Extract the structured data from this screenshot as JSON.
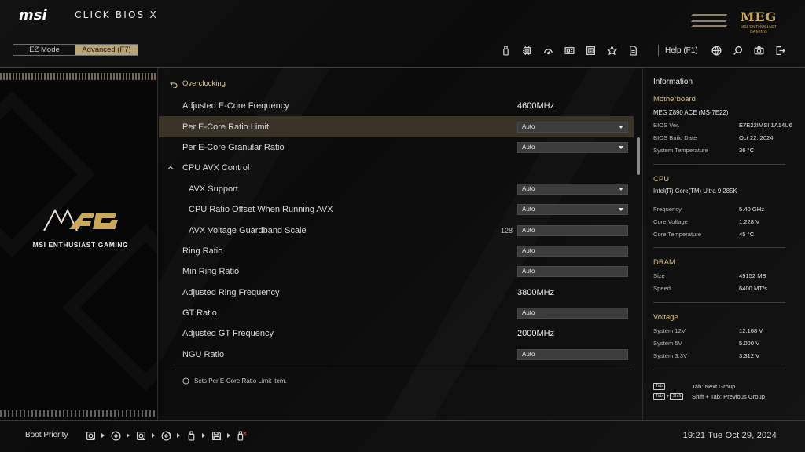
{
  "app": {
    "brand": "msi",
    "title": "CLICK BIOS X",
    "series_logo": "MEG",
    "series_caption": "MSI ENTHUSIAST GAMING"
  },
  "modes": {
    "ez": "EZ Mode",
    "advanced": "Advanced (F7)",
    "active": "advanced"
  },
  "toolbar": {
    "icons": [
      "usb-icon",
      "cpu-icon",
      "gauge-icon",
      "monitor-card-icon",
      "chip-board-icon",
      "star-icon",
      "file-icon"
    ],
    "help_label": "Help (F1)",
    "right_icons": [
      "globe-icon",
      "search-icon",
      "camera-icon",
      "exit-icon"
    ]
  },
  "left_panel": {
    "logo_caption": "MSI ENTHUSIAST GAMING"
  },
  "breadcrumb": "Overclocking",
  "settings": [
    {
      "label": "Adjusted E-Core Frequency",
      "type": "text",
      "value": "4600MHz",
      "indent": 0
    },
    {
      "label": "Per E-Core Ratio Limit",
      "type": "dropdown",
      "value": "Auto",
      "indent": 0,
      "selected": true
    },
    {
      "label": "Per E-Core Granular Ratio",
      "type": "dropdown",
      "value": "Auto",
      "indent": 0
    },
    {
      "label": "CPU AVX Control",
      "type": "group",
      "value": "",
      "indent": 0,
      "expanded": true
    },
    {
      "label": "AVX Support",
      "type": "dropdown",
      "value": "Auto",
      "indent": 1
    },
    {
      "label": "CPU Ratio Offset When Running AVX",
      "type": "dropdown",
      "value": "Auto",
      "indent": 1
    },
    {
      "label": "AVX Voltage Guardband Scale",
      "type": "input",
      "value": "Auto",
      "num": "128",
      "indent": 1
    },
    {
      "label": "Ring Ratio",
      "type": "input",
      "value": "Auto",
      "indent": 0
    },
    {
      "label": "Min Ring Ratio",
      "type": "input",
      "value": "Auto",
      "indent": 0
    },
    {
      "label": "Adjusted Ring Frequency",
      "type": "text",
      "value": "3800MHz",
      "indent": 0
    },
    {
      "label": "GT Ratio",
      "type": "input",
      "value": "Auto",
      "indent": 0
    },
    {
      "label": "Adjusted GT Frequency",
      "type": "text",
      "value": "2000MHz",
      "indent": 0
    },
    {
      "label": "NGU Ratio",
      "type": "input",
      "value": "Auto",
      "indent": 0
    }
  ],
  "help_text": "Sets Per E-Core Ratio Limit item.",
  "info": {
    "title": "Information",
    "motherboard": {
      "title": "Motherboard",
      "model": "MEG Z890 ACE (MS-7E22)",
      "rows": [
        {
          "k": "BIOS Ver.",
          "v": "E7E22IMSI.1A14U6"
        },
        {
          "k": "BIOS Build Date",
          "v": "Oct 22, 2024"
        },
        {
          "k": "System Temperature",
          "v": "36 °C"
        }
      ]
    },
    "cpu": {
      "title": "CPU",
      "model": "Intel(R) Core(TM) Ultra 9 285K",
      "rows": [
        {
          "k": "Frequency",
          "v": "5.40 GHz"
        },
        {
          "k": "Core Voltage",
          "v": "1.228 V"
        },
        {
          "k": "Core Temperature",
          "v": "45 °C"
        }
      ]
    },
    "dram": {
      "title": "DRAM",
      "rows": [
        {
          "k": "Size",
          "v": "49152 MB"
        },
        {
          "k": "Speed",
          "v": "6400 MT/s"
        }
      ]
    },
    "voltage": {
      "title": "Voltage",
      "rows": [
        {
          "k": "System 12V",
          "v": "12.168 V"
        },
        {
          "k": "System 5V",
          "v": "5.000 V"
        },
        {
          "k": "System 3.3V",
          "v": "3.312 V"
        }
      ]
    },
    "keys": [
      {
        "caps": [
          "Tab"
        ],
        "desc": "Tab: Next Group"
      },
      {
        "caps": [
          "Tab",
          "Shift"
        ],
        "desc": "Shift + Tab: Previous Group"
      }
    ]
  },
  "boot": {
    "label": "Boot Priority",
    "devices": [
      "drive-icon",
      "disc-icon",
      "drive-icon",
      "disc-icon",
      "usb-key-icon",
      "floppy-icon",
      "usb-disabled-icon"
    ]
  },
  "clock": "19:21  Tue Oct 29, 2024",
  "colors": {
    "accent": "#b8a57a",
    "gold": "#d6c08a",
    "selection": "#3a3328"
  }
}
